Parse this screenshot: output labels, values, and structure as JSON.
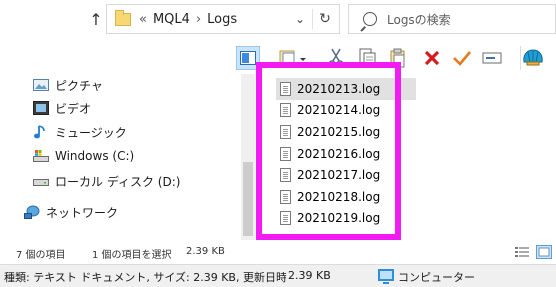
{
  "address": {
    "chevrons": "«",
    "crumbs": [
      "MQL4",
      "Logs"
    ],
    "separator": "›",
    "dropdown_glyph": "⌄",
    "refresh_glyph": "↻"
  },
  "search": {
    "placeholder": "Logsの検索"
  },
  "nav": {
    "up_glyph": "↑",
    "items": [
      {
        "label": "ピクチャ",
        "icon": "pictures-icon"
      },
      {
        "label": "ビデオ",
        "icon": "videos-icon"
      },
      {
        "label": "ミュージック",
        "icon": "music-icon"
      },
      {
        "label": "Windows (C:)",
        "icon": "drive-c-icon"
      },
      {
        "label": "ローカル ディスク (D:)",
        "icon": "drive-d-icon"
      },
      {
        "label": "ネットワーク",
        "icon": "network-icon"
      }
    ]
  },
  "files": [
    "20210213.log",
    "20210214.log",
    "20210215.log",
    "20210216.log",
    "20210217.log",
    "20210218.log",
    "20210219.log"
  ],
  "selected_file_index": 0,
  "status": {
    "item_count": "7 個の項目",
    "selection": "1 個の項目を選択",
    "size": "2.39 KB"
  },
  "details": {
    "info": "種類: テキスト ドキュメント, サイズ: 2.39 KB, 更新日時: 2",
    "size": "2.39 KB",
    "location": "コンピューター"
  },
  "colors": {
    "highlight": "#f21cf2",
    "selection": "#e1e1e1",
    "delete_red": "#d71920",
    "check_orange": "#e87a1b"
  }
}
